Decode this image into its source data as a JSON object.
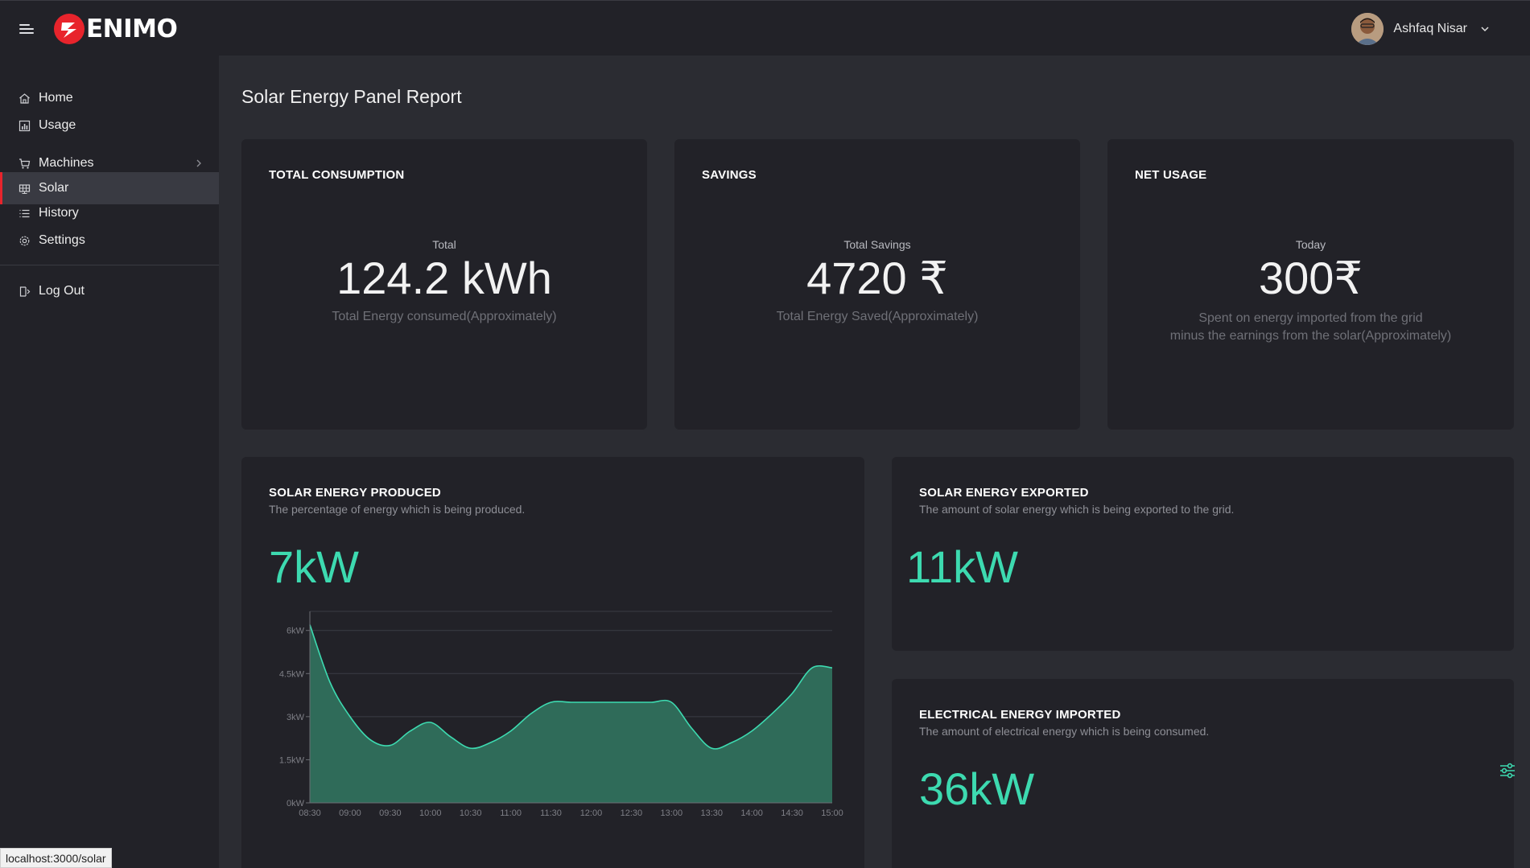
{
  "brand": {
    "name": "ENIMO",
    "accent": "#e8242c"
  },
  "user": {
    "name": "Ashfaq Nisar"
  },
  "sidebar": {
    "items": [
      {
        "label": "Home",
        "icon": "home-icon"
      },
      {
        "label": "Usage",
        "icon": "bar-chart-icon"
      },
      {
        "label": "Machines",
        "icon": "cart-icon"
      },
      {
        "label": "Solar",
        "icon": "solar-panel-icon"
      },
      {
        "label": "History",
        "icon": "list-icon"
      },
      {
        "label": "Settings",
        "icon": "gear-icon"
      },
      {
        "label": "Log Out",
        "icon": "logout-icon"
      }
    ],
    "active": "Solar"
  },
  "page": {
    "title": "Solar Energy Panel Report"
  },
  "cards": {
    "consumption": {
      "title": "TOTAL CONSUMPTION",
      "caption": "Total",
      "value": "124.2 kWh",
      "note": "Total Energy consumed(Approximately)"
    },
    "savings": {
      "title": "SAVINGS",
      "caption": "Total Savings",
      "value": "4720 ₹",
      "note": "Total Energy Saved(Approximately)"
    },
    "net": {
      "title": "NET USAGE",
      "caption": "Today",
      "value": "300₹",
      "note_line1": "Spent on energy imported from the grid",
      "note_line2": "minus the earnings from the solar(Approximately)"
    },
    "produced": {
      "title": "SOLAR ENERGY PRODUCED",
      "subtitle": "The percentage of energy which is being produced.",
      "value": "7kW"
    },
    "exported": {
      "title": "SOLAR ENERGY EXPORTED",
      "subtitle": "The amount of solar energy which is being exported to the grid.",
      "value": "11kW"
    },
    "imported": {
      "title": "ELECTRICAL ENERGY IMPORTED",
      "subtitle": "The amount of electrical energy which is being consumed.",
      "value": "36kW"
    }
  },
  "status_bar": {
    "url": "localhost:3000/solar"
  },
  "chart_data": {
    "type": "area",
    "x": [
      "08:30",
      "08:45",
      "09:00",
      "09:15",
      "09:30",
      "09:45",
      "10:00",
      "10:15",
      "10:30",
      "10:45",
      "11:00",
      "11:15",
      "11:30",
      "11:45",
      "12:00",
      "12:15",
      "12:30",
      "12:45",
      "13:00",
      "13:15",
      "13:30",
      "13:45",
      "14:00",
      "14:15",
      "14:30",
      "14:45",
      "15:00"
    ],
    "series": [
      {
        "values": [
          6.2,
          4.2,
          3.0,
          2.2,
          2.0,
          2.5,
          2.8,
          2.3,
          1.9,
          2.1,
          2.5,
          3.1,
          3.5,
          3.5,
          3.5,
          3.5,
          3.5,
          3.5,
          3.5,
          2.6,
          1.9,
          2.1,
          2.5,
          3.1,
          3.8,
          4.7,
          4.7
        ]
      }
    ],
    "xticks": [
      "08:30",
      "09:00",
      "09:30",
      "10:00",
      "10:30",
      "11:00",
      "11:30",
      "12:00",
      "12:30",
      "13:00",
      "13:30",
      "14:00",
      "14:30",
      "15:00"
    ],
    "yticks": [
      "0kW",
      "1.5kW",
      "3kW",
      "4.5kW",
      "6kW"
    ],
    "ytick_values": [
      0,
      1.5,
      3,
      4.5,
      6
    ],
    "ylim": [
      0,
      6.3
    ],
    "grid": true,
    "line_color": "#3ddab0",
    "fill_color": "#2f6b59"
  }
}
